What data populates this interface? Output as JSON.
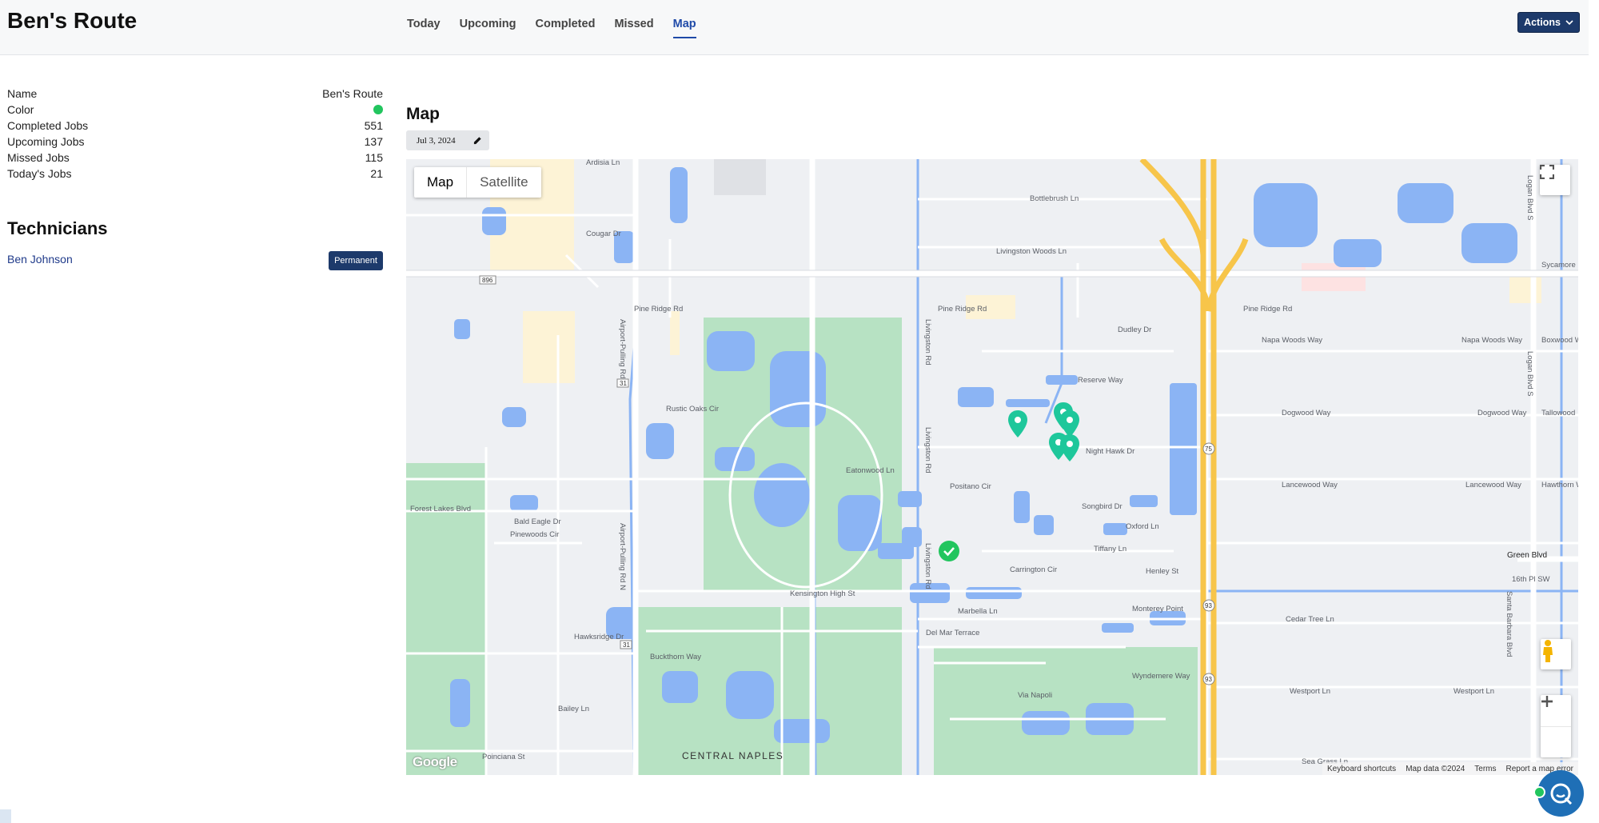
{
  "header": {
    "title": "Ben's Route",
    "tabs": [
      "Today",
      "Upcoming",
      "Completed",
      "Missed",
      "Map"
    ],
    "active_tab": "Map",
    "actions_label": "Actions"
  },
  "info": {
    "rows": [
      {
        "label": "Name",
        "value": "Ben's Route"
      },
      {
        "label": "Color",
        "value": ""
      },
      {
        "label": "Completed Jobs",
        "value": "551"
      },
      {
        "label": "Upcoming Jobs",
        "value": "137"
      },
      {
        "label": "Missed Jobs",
        "value": "115"
      },
      {
        "label": "Today's Jobs",
        "value": "21"
      }
    ],
    "route_color": "#22c55e"
  },
  "technicians": {
    "title": "Technicians",
    "items": [
      {
        "name": "Ben Johnson",
        "badge": "Permanent"
      }
    ]
  },
  "map_section": {
    "heading": "Map",
    "date": "Jul 3, 2024",
    "map_type_map": "Map",
    "map_type_satellite": "Satellite",
    "attribution": {
      "shortcuts": "Keyboard shortcuts",
      "data": "Map data ©2024",
      "terms": "Terms",
      "report": "Report a map error"
    },
    "logo": "Google",
    "labels": {
      "pine_ridge": "Pine Ridge Rd",
      "airport_pulling": "Airport-Pulling Rd N",
      "livingston": "Livingston Rd",
      "logan": "Logan Blvd S",
      "central_naples": "CENTRAL NAPLES",
      "green_blvd": "Green Blvd",
      "napa_woods": "Napa Woods Way",
      "dogwood": "Dogwood Way",
      "lancewood": "Lancewood Way",
      "cedar_tree": "Cedar Tree Ln",
      "westport": "Westport Ln",
      "night_hawk": "Night Hawk Dr",
      "carrington": "Carrington Cir",
      "marbella": "Marbella Ln",
      "monterey": "Monterey Point",
      "wyndemere": "Wyndemere Way",
      "forest_lakes": "Forest Lakes Blvd",
      "kensington": "Kensington High St",
      "livingston_woods": "Livingston Woods Ln",
      "bottlebrush": "Bottlebrush Ln",
      "reserve_way": "Reserve Way",
      "dudley": "Dudley Dr",
      "oxford": "Oxford Ln",
      "henley": "Henley St",
      "tiffany": "Tiffany Ln",
      "songbird": "Songbird Dr",
      "positano": "Positano Cir",
      "bald_eagle": "Bald Eagle Dr",
      "pinewoods": "Pinewoods Cir",
      "hawksridge": "Hawksridge Dr",
      "bailey": "Bailey Ln",
      "poinciana": "Poinciana St",
      "via_napoli": "Via Napoli",
      "sea_grass": "Sea Grass Ln",
      "sycamore": "Sycamore D",
      "boxwood": "Boxwood W",
      "tallowood": "Tallowood",
      "hawthorn": "Hawthorn W",
      "santa_barbara": "Santa Barbara Blvd",
      "sixteenth": "16th Pl SW",
      "rustic_oaks": "Rustic Oaks Cir",
      "eatonwood": "Eatonwood Ln",
      "buckthorn": "Buckthorn Way",
      "del_mar": "Del Mar Terrace",
      "cougar": "Cougar Dr",
      "ardisia": "Ardisia Ln",
      "rte_896": "896",
      "rte_31": "31",
      "rte_93": "93",
      "rte_75": "75"
    }
  }
}
